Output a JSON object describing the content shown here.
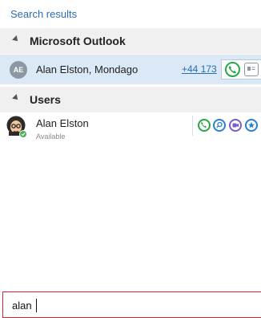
{
  "header": {
    "title": "Search results"
  },
  "groups": [
    {
      "label": "Microsoft Outlook"
    },
    {
      "label": "Users"
    }
  ],
  "outlook_contact": {
    "initials": "AE",
    "name": "Alan Elston, Mondago",
    "phone": "+44 173"
  },
  "user": {
    "name": "Alan Elston",
    "status": "Available"
  },
  "search": {
    "value": "alan"
  },
  "icons": {
    "outlook_actions": [
      "phone-icon",
      "contact-card-icon"
    ],
    "user_actions": [
      "phone-icon",
      "search-icon",
      "video-icon",
      "star-icon"
    ],
    "group_toggle": "collapse-arrow-icon"
  },
  "colors": {
    "header_text": "#2a6cb0",
    "selected_row": "#dbe9f6",
    "call_green": "#28a745",
    "presence_green": "#4caf50",
    "search_border": "#d9232c"
  }
}
